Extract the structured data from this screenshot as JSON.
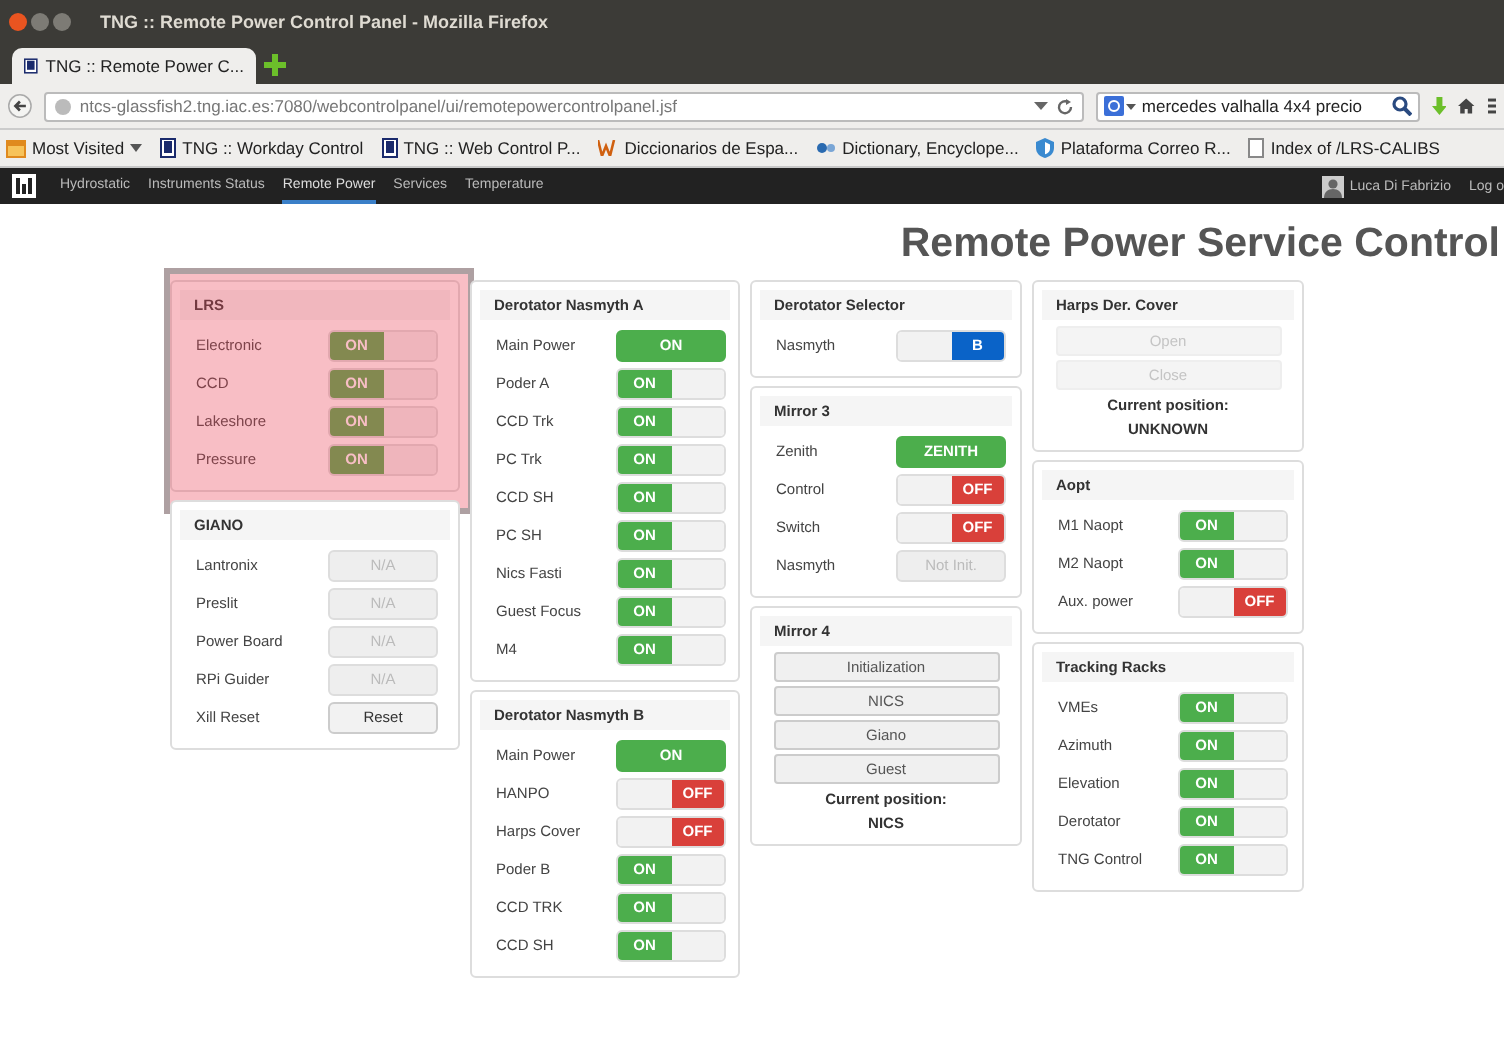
{
  "window": {
    "title": "TNG :: Remote Power Control Panel - Mozilla Firefox"
  },
  "tab": {
    "label": "TNG :: Remote Power C..."
  },
  "address_bar": {
    "url": "ntcs-glassfish2.tng.iac.es:7080/webcontrolpanel/ui/remotepowercontrolpanel.jsf"
  },
  "search": {
    "value": "mercedes valhalla 4x4 precio"
  },
  "bookmarks": [
    {
      "label": "Most Visited",
      "kind": "menu"
    },
    {
      "label": "TNG :: Workday Control",
      "kind": "page"
    },
    {
      "label": "TNG :: Web Control P...",
      "kind": "page"
    },
    {
      "label": "Diccionarios de Espa...",
      "kind": "dict"
    },
    {
      "label": "Dictionary, Encyclope...",
      "kind": "ref"
    },
    {
      "label": "Plataforma Correo R...",
      "kind": "shield"
    },
    {
      "label": "Index of /LRS-CALIBS",
      "kind": "blank"
    }
  ],
  "navbar": {
    "items": [
      {
        "label": "Hydrostatic",
        "selected": false
      },
      {
        "label": "Instruments Status",
        "selected": false
      },
      {
        "label": "Remote Power",
        "selected": true
      },
      {
        "label": "Services",
        "selected": false
      },
      {
        "label": "Temperature",
        "selected": false
      }
    ],
    "user": "Luca Di Fabrizio",
    "logout": "Log o"
  },
  "heading": "Remote Power Service Control",
  "columns": [
    {
      "panels": [
        {
          "title": "LRS",
          "highlighted": true,
          "rows": [
            {
              "label": "Electronic",
              "kind": "switch",
              "on": true,
              "text": "ON"
            },
            {
              "label": "CCD",
              "kind": "switch",
              "on": true,
              "text": "ON"
            },
            {
              "label": "Lakeshore",
              "kind": "switch",
              "on": true,
              "text": "ON"
            },
            {
              "label": "Pressure",
              "kind": "switch",
              "on": true,
              "text": "ON"
            }
          ]
        },
        {
          "title": "GIANO",
          "highlighted": false,
          "rows": [
            {
              "label": "Lantronix",
              "kind": "disabled",
              "text": "N/A"
            },
            {
              "label": "Preslit",
              "kind": "disabled",
              "text": "N/A"
            },
            {
              "label": "Power Board",
              "kind": "disabled",
              "text": "N/A"
            },
            {
              "label": "RPi Guider",
              "kind": "disabled",
              "text": "N/A"
            },
            {
              "label": "Xill Reset",
              "kind": "button",
              "text": "Reset"
            }
          ]
        }
      ]
    },
    {
      "panels": [
        {
          "title": "Derotator Nasmyth A",
          "highlighted": false,
          "rows": [
            {
              "label": "Main Power",
              "kind": "full",
              "text": "ON"
            },
            {
              "label": "Poder A",
              "kind": "switch",
              "on": true,
              "text": "ON"
            },
            {
              "label": "CCD Trk",
              "kind": "switch",
              "on": true,
              "text": "ON"
            },
            {
              "label": "PC Trk",
              "kind": "switch",
              "on": true,
              "text": "ON"
            },
            {
              "label": "CCD SH",
              "kind": "switch",
              "on": true,
              "text": "ON"
            },
            {
              "label": "PC SH",
              "kind": "switch",
              "on": true,
              "text": "ON"
            },
            {
              "label": "Nics Fasti",
              "kind": "switch",
              "on": true,
              "text": "ON"
            },
            {
              "label": "Guest Focus",
              "kind": "switch",
              "on": true,
              "text": "ON"
            },
            {
              "label": "M4",
              "kind": "switch",
              "on": true,
              "text": "ON"
            }
          ]
        },
        {
          "title": "Derotator Nasmyth B",
          "highlighted": false,
          "rows": [
            {
              "label": "Main Power",
              "kind": "full",
              "text": "ON"
            },
            {
              "label": "HANPO",
              "kind": "switch",
              "on": false,
              "text": "OFF"
            },
            {
              "label": "Harps Cover",
              "kind": "switch",
              "on": false,
              "text": "OFF"
            },
            {
              "label": "Poder B",
              "kind": "switch",
              "on": true,
              "text": "ON"
            },
            {
              "label": "CCD TRK",
              "kind": "switch",
              "on": true,
              "text": "ON"
            },
            {
              "label": "CCD SH",
              "kind": "switch",
              "on": true,
              "text": "ON"
            }
          ]
        }
      ]
    },
    {
      "panels": [
        {
          "title": "Derotator Selector",
          "highlighted": false,
          "rows": [
            {
              "label": "Nasmyth",
              "kind": "select",
              "on": true,
              "text": "B"
            }
          ]
        },
        {
          "title": "Mirror 3",
          "highlighted": false,
          "rows": [
            {
              "label": "Zenith",
              "kind": "full",
              "text": "ZENITH"
            },
            {
              "label": "Control",
              "kind": "switch",
              "on": false,
              "text": "OFF"
            },
            {
              "label": "Switch",
              "kind": "switch",
              "on": false,
              "text": "OFF"
            },
            {
              "label": "Nasmyth",
              "kind": "disabled",
              "text": "Not Init."
            }
          ]
        },
        {
          "title": "Mirror 4",
          "highlighted": false,
          "buttons": [
            {
              "label": "Initialization",
              "disabled": false
            },
            {
              "label": "NICS",
              "disabled": false
            },
            {
              "label": "Giano",
              "disabled": false
            },
            {
              "label": "Guest",
              "disabled": false
            }
          ],
          "position_label": "Current position:",
          "position": "NICS"
        }
      ]
    },
    {
      "panels": [
        {
          "title": "Harps Der. Cover",
          "highlighted": false,
          "buttons": [
            {
              "label": "Open",
              "disabled": true
            },
            {
              "label": "Close",
              "disabled": true
            }
          ],
          "position_label": "Current position:",
          "position": "UNKNOWN"
        },
        {
          "title": "Aopt",
          "highlighted": false,
          "rows": [
            {
              "label": "M1 Naopt",
              "kind": "switch",
              "on": true,
              "text": "ON"
            },
            {
              "label": "M2 Naopt",
              "kind": "switch",
              "on": true,
              "text": "ON"
            },
            {
              "label": "Aux. power",
              "kind": "switch",
              "on": false,
              "text": "OFF"
            }
          ]
        },
        {
          "title": "Tracking Racks",
          "highlighted": false,
          "rows": [
            {
              "label": "VMEs",
              "kind": "switch",
              "on": true,
              "text": "ON"
            },
            {
              "label": "Azimuth",
              "kind": "switch",
              "on": true,
              "text": "ON"
            },
            {
              "label": "Elevation",
              "kind": "switch",
              "on": true,
              "text": "ON"
            },
            {
              "label": "Derotator",
              "kind": "switch",
              "on": true,
              "text": "ON"
            },
            {
              "label": "TNG Control",
              "kind": "switch",
              "on": true,
              "text": "ON"
            }
          ]
        }
      ]
    }
  ]
}
